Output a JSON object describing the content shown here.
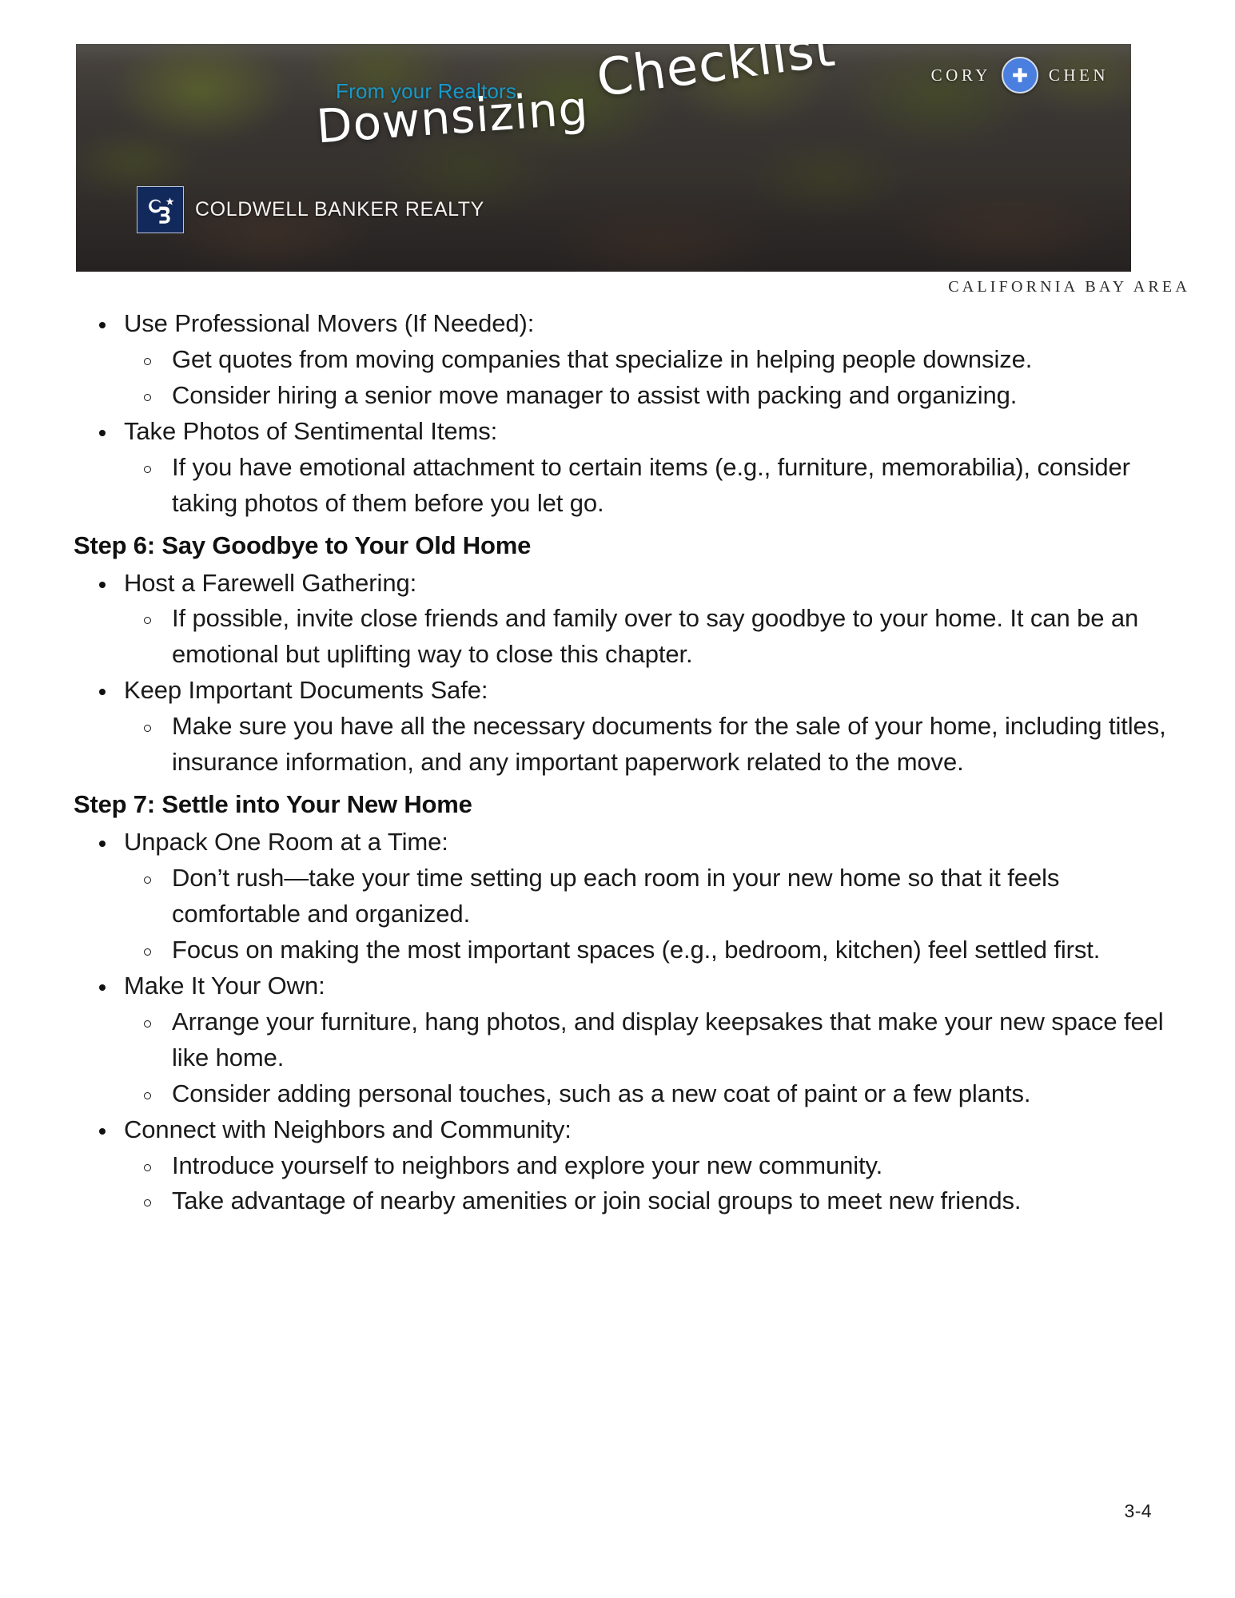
{
  "banner": {
    "kicker": "From your Realtors",
    "title_word_1": "Downsizing",
    "title_word_2": "Checklist",
    "agent_first": "CORY",
    "agent_last": "CHEN",
    "badge_icon": "plus-cross-icon",
    "brokerage": "COLDWELL BANKER REALTY",
    "logo_icon": "coldwell-banker-cb-logo",
    "region": "CALIFORNIA BAY AREA",
    "accent_kicker_color": "#1899C8",
    "badge_color": "#4A7FE0",
    "logo_color": "#12295C"
  },
  "content": {
    "blocks": [
      {
        "type": "lvl1",
        "text": "Use Professional Movers (If Needed):"
      },
      {
        "type": "lvl2",
        "text": "Get quotes from moving companies that specialize in helping people downsize."
      },
      {
        "type": "lvl2",
        "text": "Consider hiring a senior move manager to assist with packing and organizing."
      },
      {
        "type": "lvl1",
        "text": "Take Photos of Sentimental Items:"
      },
      {
        "type": "lvl2",
        "text": "If you have emotional attachment to certain items (e.g., furniture, memorabilia), consider taking photos of them before you let go."
      },
      {
        "type": "head",
        "text": "Step 6: Say Goodbye to Your Old Home"
      },
      {
        "type": "lvl1",
        "text": "Host a Farewell Gathering:"
      },
      {
        "type": "lvl2",
        "text": "If possible, invite close friends and family over to say goodbye to your home. It can be an emotional but uplifting way to close this chapter."
      },
      {
        "type": "lvl1",
        "text": "Keep Important Documents Safe:"
      },
      {
        "type": "lvl2",
        "text": "Make sure you have all the necessary documents for the sale of your home, including titles, insurance information, and any important paperwork related to the move."
      },
      {
        "type": "head",
        "text": "Step 7: Settle into Your New Home"
      },
      {
        "type": "lvl1",
        "text": "Unpack One Room at a Time:"
      },
      {
        "type": "lvl2",
        "text": "Don’t rush—take your time setting up each room in your new home so that it feels comfortable and organized."
      },
      {
        "type": "lvl2",
        "text": "Focus on making the most important spaces (e.g., bedroom, kitchen) feel settled first."
      },
      {
        "type": "lvl1",
        "text": "Make It Your Own:"
      },
      {
        "type": "lvl2",
        "text": "Arrange your furniture, hang photos, and display keepsakes that make your new space feel like home."
      },
      {
        "type": "lvl2",
        "text": "Consider adding personal touches, such as a new coat of paint or a few plants."
      },
      {
        "type": "lvl1",
        "text": "Connect with Neighbors and Community:"
      },
      {
        "type": "lvl2",
        "text": "Introduce yourself to neighbors and explore your new community."
      },
      {
        "type": "lvl2",
        "text": "Take advantage of nearby amenities or join social groups to meet new friends."
      }
    ]
  },
  "footer": {
    "page_number": "3-4"
  }
}
